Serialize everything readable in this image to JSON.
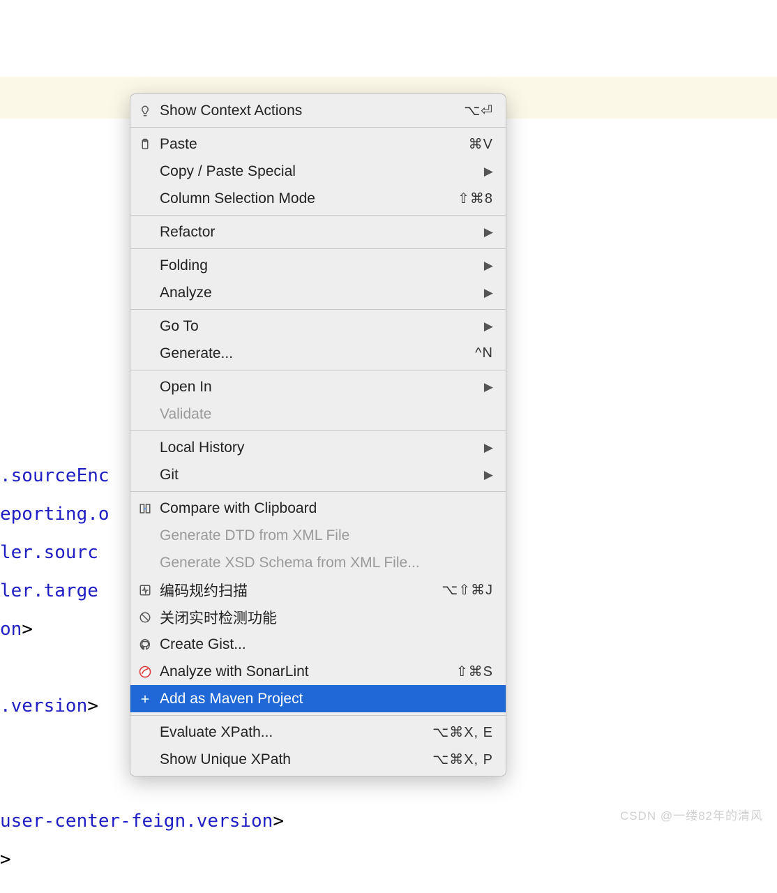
{
  "code_lines": [
    ".sourceEnc",
    "eporting.o",
    "ler.sourc",
    "ler.targe",
    "on>",
    "",
    ".version>",
    "",
    "",
    "user-center-feign.version>",
    ">"
  ],
  "menu": {
    "groups": [
      [
        {
          "icon": "bulb",
          "label": "Show Context Actions",
          "shortcut": "⌥⏎",
          "interact": true
        }
      ],
      [
        {
          "icon": "clipboard",
          "label": "Paste",
          "shortcut": "⌘V",
          "interact": true
        },
        {
          "icon": "",
          "label": "Copy / Paste Special",
          "submenu": true,
          "interact": true
        },
        {
          "icon": "",
          "label": "Column Selection Mode",
          "shortcut": "⇧⌘8",
          "interact": true
        }
      ],
      [
        {
          "icon": "",
          "label": "Refactor",
          "submenu": true,
          "interact": true
        }
      ],
      [
        {
          "icon": "",
          "label": "Folding",
          "submenu": true,
          "interact": true
        },
        {
          "icon": "",
          "label": "Analyze",
          "submenu": true,
          "interact": true
        }
      ],
      [
        {
          "icon": "",
          "label": "Go To",
          "submenu": true,
          "interact": true
        },
        {
          "icon": "",
          "label": "Generate...",
          "shortcut": "^N",
          "interact": true
        }
      ],
      [
        {
          "icon": "",
          "label": "Open In",
          "submenu": true,
          "interact": true
        },
        {
          "icon": "",
          "label": "Validate",
          "disabled": true,
          "interact": false
        }
      ],
      [
        {
          "icon": "",
          "label": "Local History",
          "submenu": true,
          "interact": true
        },
        {
          "icon": "",
          "label": "Git",
          "submenu": true,
          "interact": true
        }
      ],
      [
        {
          "icon": "compare",
          "label": "Compare with Clipboard",
          "interact": true
        },
        {
          "icon": "",
          "label": "Generate DTD from XML File",
          "disabled": true,
          "interact": false
        },
        {
          "icon": "",
          "label": "Generate XSD Schema from XML File...",
          "disabled": true,
          "interact": false
        },
        {
          "icon": "pulse",
          "label": "编码规约扫描",
          "shortcut": "⌥⇧⌘J",
          "interact": true
        },
        {
          "icon": "ban",
          "label": "关闭实时检测功能",
          "interact": true
        },
        {
          "icon": "github",
          "label": "Create Gist...",
          "interact": true
        },
        {
          "icon": "sonar",
          "label": "Analyze with SonarLint",
          "shortcut": "⇧⌘S",
          "interact": true
        },
        {
          "icon": "plus",
          "label": "Add as Maven Project",
          "selected": true,
          "interact": true
        }
      ],
      [
        {
          "icon": "",
          "label": "Evaluate XPath...",
          "shortcut": "⌥⌘X, E",
          "interact": true
        },
        {
          "icon": "",
          "label": "Show Unique XPath",
          "shortcut": "⌥⌘X, P",
          "interact": true
        }
      ]
    ]
  },
  "watermark": "CSDN @一缕82年的清风"
}
